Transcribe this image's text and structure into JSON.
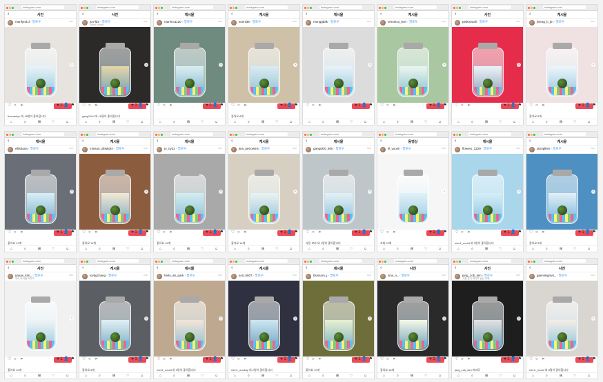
{
  "browser": {
    "url": "instagram.com"
  },
  "post": {
    "follow": "팔로우",
    "notification_badge": "♥ 1  👤"
  },
  "rows": [
    [
      {
        "title": "사진",
        "username": "marilynd.d",
        "sub": "",
        "bg": "#e7e3df",
        "water": "#e8f4f8",
        "caption": "themarilyn 외 18명이 좋아합니다"
      },
      {
        "title": "사진",
        "username": "jun*ld4",
        "sub": "Seoul, Korea",
        "bg": "#2c2a28",
        "water": "#e6d6a8",
        "caption": "gang1004 외 18명이 좋아합니다"
      },
      {
        "title": "게시물",
        "username": "marimo1120",
        "sub": "",
        "bg": "#6f8a7e",
        "water": "#dbeef2",
        "caption": ""
      },
      {
        "title": "게시물",
        "username": "sunnl38",
        "sub": "",
        "bg": "#cfc1a8",
        "water": "#d9ecf3",
        "caption": "좋아요 8개"
      },
      {
        "title": "게시물",
        "username": "monggbak",
        "sub": "",
        "bg": "#dcdcdc",
        "water": "#e8f3f9",
        "caption": ""
      },
      {
        "title": "게시물",
        "username": "veronica_bori",
        "sub": "",
        "bg": "#a9c7a0",
        "water": "#ecf6ef",
        "caption": ""
      },
      {
        "title": "사진",
        "username": "petitmarali",
        "sub": "",
        "bg": "#e52d4b",
        "water": "#eaf5f9",
        "caption": ""
      },
      {
        "title": "게시물",
        "username": "jiseog_b_jin",
        "sub": "",
        "bg": "#f0e1e3",
        "water": "#edf6fb",
        "caption": "좋아요 8개"
      }
    ],
    [
      {
        "title": "게시물",
        "username": "ellisbana",
        "sub": "",
        "bg": "#6a6f77",
        "water": "#d7eef7",
        "caption": "좋아요 12개"
      },
      {
        "title": "게시물",
        "username": "minsun_dlrwkdnr",
        "sub": "",
        "bg": "#8c5c3f",
        "water": "#f1e9d6",
        "caption": "좋아요 11개"
      },
      {
        "title": "게시물",
        "username": "jo_ny22",
        "sub": "",
        "bg": "#a9a9a9",
        "water": "#d2eef1",
        "caption": "좋아요 16개"
      },
      {
        "title": "게시물",
        "username": "jina_petrowins",
        "sub": "",
        "bg": "#d7d0c2",
        "water": "#ebf3f2",
        "caption": "좋아요 14개"
      },
      {
        "title": "게시물",
        "username": "gangul00_800",
        "sub": "",
        "bg": "#bfc6c9",
        "water": "#e4f1f6",
        "caption": "사랑 보라 외 1명이 좋아합니다"
      },
      {
        "title": "동영상",
        "username": "ill_yoonii",
        "sub": "",
        "bg": "#f6f6f6",
        "water": "#e0f1f7",
        "caption": "조회 22회"
      },
      {
        "title": "게시물",
        "username": "flowery_2229",
        "sub": "",
        "bg": "#a9d6ea",
        "water": "#d6eef8",
        "caption": "mim1_ooold 외 3명이 좋아합니다"
      },
      {
        "title": "게시물",
        "username": "dumplkim",
        "sub": "",
        "bg": "#4f90c2",
        "water": "#e2f0f7",
        "caption": "좋아요 5개"
      }
    ],
    [
      {
        "title": "사진",
        "username": "yanas_kim_",
        "sub": "우리 아이들 마리모",
        "bg": "#f1f1f1",
        "water": "#f0f4f5",
        "caption": "좋아요 10개"
      },
      {
        "title": "게시물",
        "username": "lovdgchang",
        "sub": "",
        "bg": "#5b5f63",
        "water": "#dfeff4",
        "caption": "좋아요 5개"
      },
      {
        "title": "게시물",
        "username": "hello_ah_park",
        "sub": "",
        "bg": "#bfa890",
        "water": "#f2e6d8",
        "caption": "mim1_ooold 외 2명이 좋아합니다"
      },
      {
        "title": "게시물",
        "username": "soit_0807",
        "sub": "",
        "bg": "#2f3140",
        "water": "#cde6f1",
        "caption": "mim1_oookdy 외 2명이 좋아합니다"
      },
      {
        "title": "게시물",
        "username": "blossom_j",
        "sub": "",
        "bg": "#6e6e3b",
        "water": "#e6f0d2",
        "caption": "좋아요 10개"
      },
      {
        "title": "사진",
        "username": "Jins_n_",
        "sub": "",
        "bg": "#2a2a2a",
        "water": "#f4f8e8",
        "caption": "좋아요 16개"
      },
      {
        "title": "사진",
        "username": "jang_zob_kim",
        "sub": "서울 경기 마리모 농장 카페",
        "bg": "#1e1e1e",
        "water": "#e2e2e2",
        "caption": "jang_zob_kim 마리모"
      },
      {
        "title": "사진",
        "username": "gaerolegram_",
        "sub": "",
        "bg": "#d9d6d2",
        "water": "#f3eee6",
        "caption": "mim1_ooold 외 8명이 좋아합니다"
      }
    ]
  ]
}
